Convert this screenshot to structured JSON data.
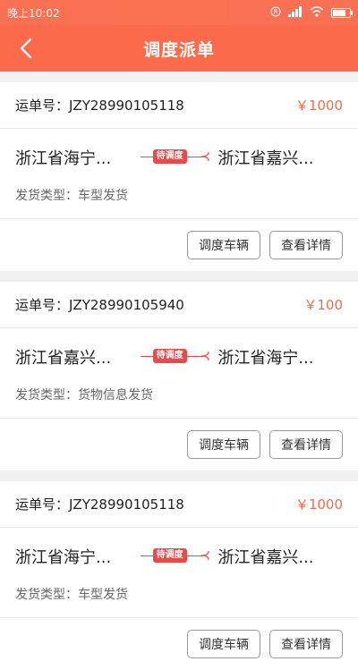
{
  "status_bar": {
    "time": "晚上10:02",
    "battery_level": 0.8
  },
  "header": {
    "title": "调度派单",
    "back_icon": "chevron-left-icon"
  },
  "accent_color": "#fb6a4a",
  "orders": [
    {
      "order_label": "运单号：JZY28990105118",
      "price": "￥1000",
      "from": "浙江省海宁...",
      "to": "浙江省嘉兴...",
      "status": "待调度",
      "type": "发货类型：车型发货",
      "actions": [
        "调度车辆",
        "查看详情"
      ]
    },
    {
      "order_label": "运单号：JZY28990105940",
      "price": "￥100",
      "from": "浙江省嘉兴...",
      "to": "浙江省海宁...",
      "status": "待调度",
      "type": "发货类型：货物信息发货",
      "actions": [
        "调度车辆",
        "查看详情"
      ]
    },
    {
      "order_label": "运单号：JZY28990105118",
      "price": "￥1000",
      "from": "浙江省海宁...",
      "to": "浙江省嘉兴...",
      "status": "待调度",
      "type": "发货类型：车型发货",
      "actions": [
        "调度车辆",
        "查看详情"
      ]
    }
  ]
}
